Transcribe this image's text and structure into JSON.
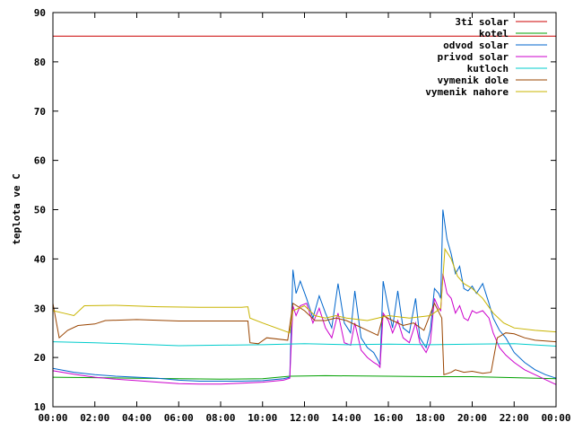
{
  "chart_data": {
    "type": "line",
    "title": "",
    "xlabel": "",
    "ylabel": "teplota ve C",
    "xlim": [
      0,
      24
    ],
    "ylim": [
      10,
      90
    ],
    "grid": false,
    "legend": "top-right",
    "x_ticks": [
      {
        "value": 0,
        "label": "00:00"
      },
      {
        "value": 2,
        "label": "02:00"
      },
      {
        "value": 4,
        "label": "04:00"
      },
      {
        "value": 6,
        "label": "06:00"
      },
      {
        "value": 8,
        "label": "08:00"
      },
      {
        "value": 10,
        "label": "10:00"
      },
      {
        "value": 12,
        "label": "12:00"
      },
      {
        "value": 14,
        "label": "14:00"
      },
      {
        "value": 16,
        "label": "16:00"
      },
      {
        "value": 18,
        "label": "18:00"
      },
      {
        "value": 20,
        "label": "20:00"
      },
      {
        "value": 22,
        "label": "22:00"
      },
      {
        "value": 24,
        "label": "00:00"
      }
    ],
    "y_ticks": [
      {
        "value": 10,
        "label": "10"
      },
      {
        "value": 20,
        "label": "20"
      },
      {
        "value": 30,
        "label": "30"
      },
      {
        "value": 40,
        "label": "40"
      },
      {
        "value": 50,
        "label": "50"
      },
      {
        "value": 60,
        "label": "60"
      },
      {
        "value": 70,
        "label": "70"
      },
      {
        "value": 80,
        "label": "80"
      },
      {
        "value": 90,
        "label": "90"
      }
    ],
    "series": [
      {
        "name": "3ti solar",
        "color": "#cc0000",
        "points": [
          [
            0,
            85.2
          ],
          [
            24,
            85.2
          ]
        ]
      },
      {
        "name": "kotel",
        "color": "#00a000",
        "points": [
          [
            0,
            16.0
          ],
          [
            4,
            15.8
          ],
          [
            8,
            15.6
          ],
          [
            10,
            15.7
          ],
          [
            11.3,
            16.2
          ],
          [
            13,
            16.3
          ],
          [
            16,
            16.2
          ],
          [
            18,
            16.1
          ],
          [
            20,
            16.1
          ],
          [
            22,
            15.9
          ],
          [
            24,
            15.7
          ]
        ]
      },
      {
        "name": "odvod solar",
        "color": "#0066cc",
        "points": [
          [
            0,
            17.8
          ],
          [
            1,
            17.0
          ],
          [
            2,
            16.5
          ],
          [
            3,
            16.2
          ],
          [
            4,
            16.0
          ],
          [
            5,
            15.8
          ],
          [
            6,
            15.4
          ],
          [
            7,
            15.2
          ],
          [
            8,
            15.2
          ],
          [
            9,
            15.2
          ],
          [
            10,
            15.3
          ],
          [
            11,
            15.7
          ],
          [
            11.3,
            16.0
          ],
          [
            11.45,
            37.8
          ],
          [
            11.6,
            33.0
          ],
          [
            11.8,
            35.5
          ],
          [
            12.1,
            32.0
          ],
          [
            12.4,
            28.0
          ],
          [
            12.7,
            32.5
          ],
          [
            13.0,
            29.0
          ],
          [
            13.3,
            26.0
          ],
          [
            13.6,
            35.0
          ],
          [
            13.9,
            27.0
          ],
          [
            14.2,
            25.0
          ],
          [
            14.4,
            33.5
          ],
          [
            14.7,
            24.0
          ],
          [
            15.0,
            22.0
          ],
          [
            15.3,
            21.0
          ],
          [
            15.5,
            19.5
          ],
          [
            15.6,
            18.5
          ],
          [
            15.75,
            35.5
          ],
          [
            16.0,
            30.0
          ],
          [
            16.2,
            26.0
          ],
          [
            16.45,
            33.5
          ],
          [
            16.7,
            26.0
          ],
          [
            17.0,
            25.0
          ],
          [
            17.3,
            32.0
          ],
          [
            17.5,
            24.0
          ],
          [
            17.8,
            22.0
          ],
          [
            18.0,
            25.5
          ],
          [
            18.2,
            34.0
          ],
          [
            18.4,
            33.0
          ],
          [
            18.5,
            32.0
          ],
          [
            18.6,
            50.0
          ],
          [
            18.8,
            44.0
          ],
          [
            19.0,
            41.0
          ],
          [
            19.2,
            37.0
          ],
          [
            19.4,
            38.5
          ],
          [
            19.6,
            34.0
          ],
          [
            19.8,
            33.5
          ],
          [
            20.0,
            34.5
          ],
          [
            20.2,
            33.0
          ],
          [
            20.5,
            35.0
          ],
          [
            20.8,
            31.0
          ],
          [
            21.0,
            28.0
          ],
          [
            21.3,
            25.5
          ],
          [
            21.6,
            24.0
          ],
          [
            22.0,
            21.0
          ],
          [
            22.5,
            19.0
          ],
          [
            23.0,
            17.5
          ],
          [
            23.5,
            16.5
          ],
          [
            24,
            15.8
          ]
        ]
      },
      {
        "name": "privod solar",
        "color": "#cc00cc",
        "points": [
          [
            0,
            17.3
          ],
          [
            1,
            16.6
          ],
          [
            2,
            16.0
          ],
          [
            3,
            15.6
          ],
          [
            4,
            15.3
          ],
          [
            5,
            15.0
          ],
          [
            6,
            14.7
          ],
          [
            7,
            14.6
          ],
          [
            8,
            14.6
          ],
          [
            9,
            14.8
          ],
          [
            10,
            15.0
          ],
          [
            11,
            15.4
          ],
          [
            11.3,
            15.8
          ],
          [
            11.45,
            30.5
          ],
          [
            11.6,
            28.5
          ],
          [
            11.8,
            30.5
          ],
          [
            12.1,
            31.0
          ],
          [
            12.4,
            27.0
          ],
          [
            12.7,
            30.0
          ],
          [
            13.0,
            26.0
          ],
          [
            13.3,
            24.0
          ],
          [
            13.6,
            29.0
          ],
          [
            13.9,
            23.0
          ],
          [
            14.2,
            22.5
          ],
          [
            14.4,
            27.0
          ],
          [
            14.7,
            21.5
          ],
          [
            15.0,
            20.0
          ],
          [
            15.3,
            19.0
          ],
          [
            15.5,
            18.5
          ],
          [
            15.6,
            18.0
          ],
          [
            15.75,
            29.0
          ],
          [
            16.0,
            27.5
          ],
          [
            16.2,
            25.0
          ],
          [
            16.45,
            27.5
          ],
          [
            16.7,
            24.0
          ],
          [
            17.0,
            23.0
          ],
          [
            17.3,
            27.0
          ],
          [
            17.5,
            23.0
          ],
          [
            17.8,
            21.0
          ],
          [
            18.0,
            23.0
          ],
          [
            18.2,
            32.0
          ],
          [
            18.4,
            30.0
          ],
          [
            18.5,
            29.5
          ],
          [
            18.6,
            37.0
          ],
          [
            18.8,
            33.0
          ],
          [
            19.0,
            32.0
          ],
          [
            19.2,
            29.0
          ],
          [
            19.4,
            30.5
          ],
          [
            19.6,
            28.0
          ],
          [
            19.8,
            27.5
          ],
          [
            20.0,
            29.5
          ],
          [
            20.2,
            29.0
          ],
          [
            20.5,
            29.5
          ],
          [
            20.8,
            28.0
          ],
          [
            21.0,
            25.0
          ],
          [
            21.3,
            22.0
          ],
          [
            21.6,
            20.5
          ],
          [
            22.0,
            19.0
          ],
          [
            22.5,
            17.5
          ],
          [
            23.0,
            16.5
          ],
          [
            23.5,
            15.5
          ],
          [
            24,
            14.5
          ]
        ]
      },
      {
        "name": "kutloch",
        "color": "#00cccc",
        "points": [
          [
            0,
            23.2
          ],
          [
            2,
            23.0
          ],
          [
            4,
            22.7
          ],
          [
            6,
            22.4
          ],
          [
            8,
            22.5
          ],
          [
            10,
            22.6
          ],
          [
            12,
            22.8
          ],
          [
            14,
            22.6
          ],
          [
            16,
            22.7
          ],
          [
            18,
            22.6
          ],
          [
            20,
            22.7
          ],
          [
            22,
            22.8
          ],
          [
            24,
            22.3
          ]
        ]
      },
      {
        "name": "vymenik dole",
        "color": "#994400",
        "points": [
          [
            0,
            31.0
          ],
          [
            0.3,
            24.0
          ],
          [
            0.7,
            25.5
          ],
          [
            1.2,
            26.5
          ],
          [
            2,
            26.8
          ],
          [
            2.5,
            27.5
          ],
          [
            4,
            27.7
          ],
          [
            6,
            27.4
          ],
          [
            8,
            27.4
          ],
          [
            9.3,
            27.4
          ],
          [
            9.4,
            23.0
          ],
          [
            9.8,
            22.8
          ],
          [
            10.2,
            24.0
          ],
          [
            11.2,
            23.5
          ],
          [
            11.45,
            31.0
          ],
          [
            12.0,
            29.5
          ],
          [
            12.5,
            27.5
          ],
          [
            13.0,
            27.5
          ],
          [
            13.5,
            28.0
          ],
          [
            14.0,
            27.5
          ],
          [
            14.5,
            26.5
          ],
          [
            15.0,
            25.5
          ],
          [
            15.5,
            24.5
          ],
          [
            15.75,
            28.5
          ],
          [
            16.2,
            27.5
          ],
          [
            16.7,
            26.5
          ],
          [
            17.2,
            27.0
          ],
          [
            17.7,
            25.5
          ],
          [
            18.2,
            31.0
          ],
          [
            18.55,
            28.0
          ],
          [
            18.65,
            16.5
          ],
          [
            19.0,
            17.0
          ],
          [
            19.2,
            17.5
          ],
          [
            19.6,
            17.0
          ],
          [
            20.0,
            17.2
          ],
          [
            20.5,
            16.8
          ],
          [
            20.9,
            17.0
          ],
          [
            21.2,
            24.0
          ],
          [
            21.6,
            25.0
          ],
          [
            22.0,
            24.8
          ],
          [
            22.5,
            24.0
          ],
          [
            23.0,
            23.5
          ],
          [
            24,
            23.2
          ]
        ]
      },
      {
        "name": "vymenik nahore",
        "color": "#c8b400",
        "points": [
          [
            0,
            29.5
          ],
          [
            0.5,
            29.0
          ],
          [
            1.0,
            28.5
          ],
          [
            1.5,
            30.5
          ],
          [
            3,
            30.6
          ],
          [
            5,
            30.3
          ],
          [
            7,
            30.2
          ],
          [
            9,
            30.2
          ],
          [
            9.3,
            30.3
          ],
          [
            9.4,
            28.0
          ],
          [
            10,
            27.0
          ],
          [
            11.3,
            25.0
          ],
          [
            11.45,
            29.5
          ],
          [
            12,
            30.5
          ],
          [
            12.5,
            28.5
          ],
          [
            13,
            28.0
          ],
          [
            13.5,
            28.5
          ],
          [
            14,
            28.0
          ],
          [
            15,
            27.5
          ],
          [
            16,
            28.5
          ],
          [
            17,
            28.0
          ],
          [
            18,
            28.5
          ],
          [
            18.5,
            30.0
          ],
          [
            18.7,
            42.0
          ],
          [
            19.0,
            40.0
          ],
          [
            19.3,
            36.5
          ],
          [
            19.6,
            35.0
          ],
          [
            20.0,
            34.0
          ],
          [
            20.5,
            32.0
          ],
          [
            21.0,
            29.0
          ],
          [
            21.5,
            27.0
          ],
          [
            22.0,
            26.0
          ],
          [
            23.0,
            25.5
          ],
          [
            24,
            25.2
          ]
        ]
      }
    ]
  }
}
